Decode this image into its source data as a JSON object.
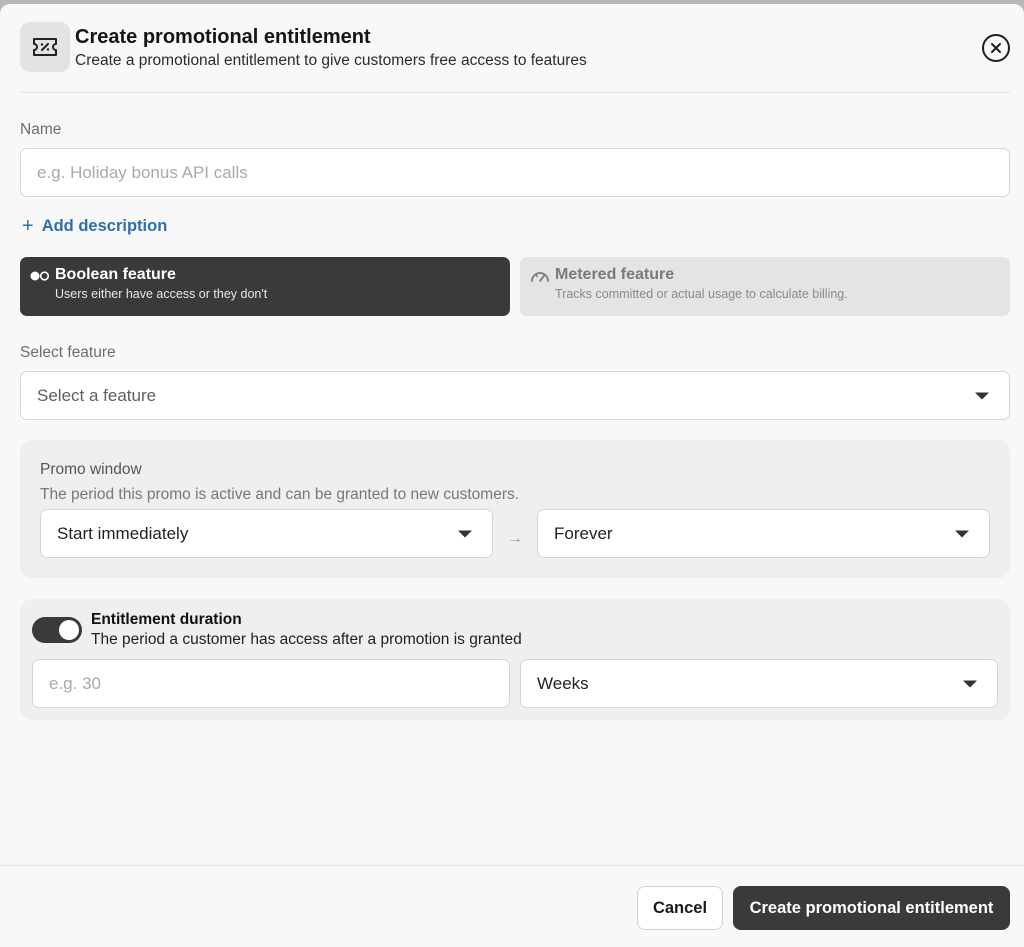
{
  "header": {
    "title": "Create promotional entitlement",
    "subtitle": "Create a promotional entitlement to give customers free access to features",
    "icon": "ticket-percent-icon",
    "close_icon": "close-circle-icon"
  },
  "name": {
    "label": "Name",
    "placeholder": "e.g. Holiday bonus API calls",
    "value": ""
  },
  "add_description": {
    "icon": "plus-icon",
    "plus": "+",
    "label": "Add description"
  },
  "feature_types": [
    {
      "title": "Boolean feature",
      "subtitle": "Users either have access or they don't",
      "icon": "toggle-dots-icon",
      "selected": true
    },
    {
      "title": "Metered feature",
      "subtitle": "Tracks committed or actual usage to calculate billing.",
      "icon": "gauge-icon",
      "selected": false
    }
  ],
  "select_feature": {
    "label": "Select feature",
    "placeholder": "Select a feature"
  },
  "promo_window": {
    "title": "Promo window",
    "subtitle": "The period this promo is active and can be granted to new customers.",
    "start": "Start immediately",
    "arrow": "→",
    "end": "Forever"
  },
  "entitlement_duration": {
    "enabled": true,
    "title": "Entitlement duration",
    "subtitle": "The period a customer has access after a promotion is granted",
    "amount_placeholder": "e.g. 30",
    "unit": "Weeks"
  },
  "footer": {
    "cancel": "Cancel",
    "create": "Create promotional entitlement"
  },
  "colors": {
    "dark": "#3a3a3a",
    "link": "#2c6fae",
    "background": "#f8f8f8"
  }
}
